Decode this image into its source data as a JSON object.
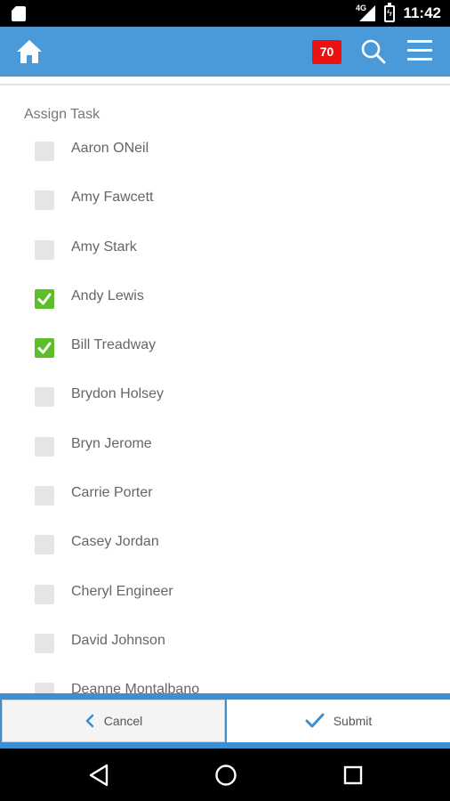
{
  "status_bar": {
    "network_type": "4G",
    "time": "11:42"
  },
  "app_bar": {
    "notification_count": "70"
  },
  "form": {
    "section_label": "Assign Task",
    "assignees": [
      {
        "name": "Aaron ONeil",
        "checked": false
      },
      {
        "name": "Amy Fawcett",
        "checked": false
      },
      {
        "name": "Amy Stark",
        "checked": false
      },
      {
        "name": "Andy Lewis",
        "checked": true
      },
      {
        "name": "Bill Treadway",
        "checked": true
      },
      {
        "name": "Brydon Holsey",
        "checked": false
      },
      {
        "name": "Bryn Jerome",
        "checked": false
      },
      {
        "name": "Carrie Porter",
        "checked": false
      },
      {
        "name": "Casey Jordan",
        "checked": false
      },
      {
        "name": "Cheryl Engineer",
        "checked": false
      },
      {
        "name": "David Johnson",
        "checked": false
      },
      {
        "name": "Deanne Montalbano",
        "checked": false
      }
    ]
  },
  "actions": {
    "cancel_label": "Cancel",
    "submit_label": "Submit"
  },
  "colors": {
    "app_bar": "#4a9ad9",
    "badge": "#ee1111",
    "checked": "#5cbf2a",
    "accent": "#3d8fd1"
  }
}
